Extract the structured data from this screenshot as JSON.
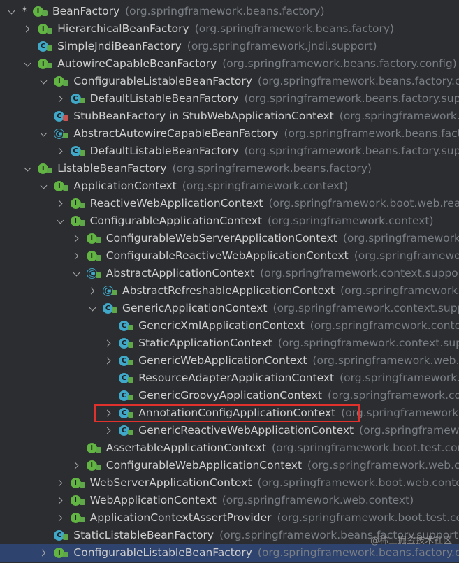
{
  "watermark": "@稀土掘金技术社区",
  "rows": [
    {
      "indent": 0,
      "arrow": "exp",
      "star": true,
      "icon": "I",
      "badge": "open",
      "name": "BeanFactory",
      "pkg": "(org.springframework.beans.factory)"
    },
    {
      "indent": 1,
      "arrow": "col",
      "icon": "I",
      "badge": "open",
      "name": "HierarchicalBeanFactory",
      "pkg": "(org.springframework.beans.factory)"
    },
    {
      "indent": 1,
      "arrow": "",
      "icon": "C",
      "badge": "open",
      "name": "SimpleJndiBeanFactory",
      "pkg": "(org.springframework.jndi.support)"
    },
    {
      "indent": 1,
      "arrow": "exp",
      "icon": "I",
      "badge": "open",
      "name": "AutowireCapableBeanFactory",
      "pkg": "(org.springframework.beans.factory.config)"
    },
    {
      "indent": 2,
      "arrow": "exp",
      "icon": "I",
      "badge": "open",
      "name": "ConfigurableListableBeanFactory",
      "pkg": "(org.springframework.beans.factory.config)"
    },
    {
      "indent": 3,
      "arrow": "col",
      "icon": "C",
      "badge": "open",
      "name": "DefaultListableBeanFactory",
      "pkg": "(org.springframework.beans.factory.support)"
    },
    {
      "indent": 2,
      "arrow": "",
      "icon": "C",
      "badge": "lock",
      "name": "StubBeanFactory in StubWebApplicationContext",
      "pkg": "(org.springframework.web.context)"
    },
    {
      "indent": 2,
      "arrow": "exp",
      "icon": "A",
      "badge": "open",
      "name": "AbstractAutowireCapableBeanFactory",
      "pkg": "(org.springframework.beans.factory.support)"
    },
    {
      "indent": 3,
      "arrow": "col",
      "icon": "C",
      "badge": "open",
      "name": "DefaultListableBeanFactory",
      "pkg": "(org.springframework.beans.factory.support)"
    },
    {
      "indent": 1,
      "arrow": "exp",
      "icon": "I",
      "badge": "open",
      "name": "ListableBeanFactory",
      "pkg": "(org.springframework.beans.factory)"
    },
    {
      "indent": 2,
      "arrow": "exp",
      "icon": "I",
      "badge": "open",
      "name": "ApplicationContext",
      "pkg": "(org.springframework.context)"
    },
    {
      "indent": 3,
      "arrow": "col",
      "icon": "I",
      "badge": "open",
      "name": "ReactiveWebApplicationContext",
      "pkg": "(org.springframework.boot.web.reactive.context)"
    },
    {
      "indent": 3,
      "arrow": "exp",
      "icon": "I",
      "badge": "open",
      "name": "ConfigurableApplicationContext",
      "pkg": "(org.springframework.context)"
    },
    {
      "indent": 4,
      "arrow": "col",
      "icon": "I",
      "badge": "open",
      "name": "ConfigurableWebServerApplicationContext",
      "pkg": "(org.springframework.boot.web.context)"
    },
    {
      "indent": 4,
      "arrow": "col",
      "icon": "I",
      "badge": "open",
      "name": "ConfigurableReactiveWebApplicationContext",
      "pkg": "(org.springframework.boot.web.reactive.context)"
    },
    {
      "indent": 4,
      "arrow": "exp",
      "icon": "A",
      "badge": "open",
      "name": "AbstractApplicationContext",
      "pkg": "(org.springframework.context.support)"
    },
    {
      "indent": 5,
      "arrow": "col",
      "icon": "A",
      "badge": "open",
      "name": "AbstractRefreshableApplicationContext",
      "pkg": "(org.springframework.context.support)"
    },
    {
      "indent": 5,
      "arrow": "exp",
      "icon": "C",
      "badge": "open",
      "name": "GenericApplicationContext",
      "pkg": "(org.springframework.context.support)"
    },
    {
      "indent": 6,
      "arrow": "",
      "icon": "C",
      "badge": "open",
      "name": "GenericXmlApplicationContext",
      "pkg": "(org.springframework.context.support)"
    },
    {
      "indent": 6,
      "arrow": "col",
      "icon": "C",
      "badge": "open",
      "name": "StaticApplicationContext",
      "pkg": "(org.springframework.context.support)"
    },
    {
      "indent": 6,
      "arrow": "col",
      "icon": "C",
      "badge": "open",
      "name": "GenericWebApplicationContext",
      "pkg": "(org.springframework.web.context.support)"
    },
    {
      "indent": 6,
      "arrow": "",
      "icon": "C",
      "badge": "open",
      "name": "ResourceAdapterApplicationContext",
      "pkg": "(org.springframework.jca.context)"
    },
    {
      "indent": 6,
      "arrow": "",
      "icon": "C",
      "badge": "open",
      "name": "GenericGroovyApplicationContext",
      "pkg": "(org.springframework.context.support)"
    },
    {
      "indent": 6,
      "arrow": "col",
      "icon": "C",
      "badge": "open",
      "name": "AnnotationConfigApplicationContext",
      "pkg": "(org.springframework.context.annotation)"
    },
    {
      "indent": 6,
      "arrow": "col",
      "icon": "C",
      "badge": "open",
      "name": "GenericReactiveWebApplicationContext",
      "pkg": "(org.springframework.boot.web.reactive.context)"
    },
    {
      "indent": 4,
      "arrow": "",
      "icon": "I",
      "badge": "open",
      "name": "AssertableApplicationContext",
      "pkg": "(org.springframework.boot.test.context.assertj)"
    },
    {
      "indent": 4,
      "arrow": "col",
      "icon": "I",
      "badge": "open",
      "name": "ConfigurableWebApplicationContext",
      "pkg": "(org.springframework.web.context)"
    },
    {
      "indent": 3,
      "arrow": "col",
      "icon": "I",
      "badge": "open",
      "name": "WebServerApplicationContext",
      "pkg": "(org.springframework.boot.web.context)"
    },
    {
      "indent": 3,
      "arrow": "col",
      "icon": "I",
      "badge": "open",
      "name": "WebApplicationContext",
      "pkg": "(org.springframework.web.context)"
    },
    {
      "indent": 3,
      "arrow": "col",
      "icon": "I",
      "badge": "open",
      "name": "ApplicationContextAssertProvider",
      "pkg": "(org.springframework.boot.test.context.assertj)"
    },
    {
      "indent": 2,
      "arrow": "",
      "icon": "C",
      "badge": "open",
      "name": "StaticListableBeanFactory",
      "pkg": "(org.springframework.beans.factory.support)"
    },
    {
      "indent": 2,
      "arrow": "col",
      "icon": "I",
      "badge": "open",
      "name": "ConfigurableListableBeanFactory",
      "pkg": "(org.springframework.beans.factory.config)",
      "selected": true
    }
  ]
}
